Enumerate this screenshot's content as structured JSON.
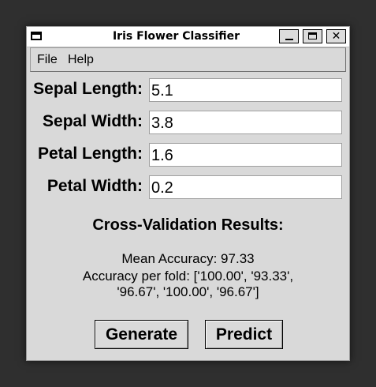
{
  "window": {
    "title": "Iris Flower Classifier",
    "close_glyph": "✕"
  },
  "menu": {
    "file": "File",
    "help": "Help"
  },
  "form": {
    "sepal_length_label": "Sepal Length:",
    "sepal_length_value": "5.1",
    "sepal_width_label": "Sepal Width:",
    "sepal_width_value": "3.8",
    "petal_length_label": "Petal Length:",
    "petal_length_value": "1.6",
    "petal_width_label": "Petal Width:",
    "petal_width_value": "0.2"
  },
  "results": {
    "title": "Cross-Validation Results:",
    "mean_accuracy": "Mean Accuracy: 97.33",
    "per_fold_line1": "Accuracy per fold: ['100.00', '93.33',",
    "per_fold_line2": "'96.67', '100.00', '96.67']"
  },
  "buttons": {
    "generate": "Generate",
    "predict": "Predict"
  },
  "icons": {
    "window_menu": "window-menu-icon",
    "minimize": "minimize-icon",
    "maximize": "maximize-icon",
    "close": "close-icon"
  }
}
